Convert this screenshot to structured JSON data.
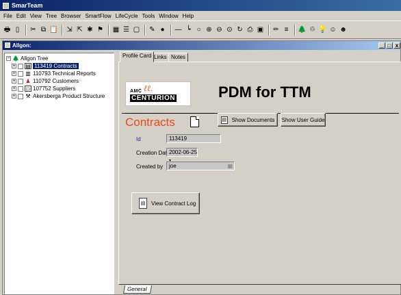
{
  "app": {
    "title": "SmarTeam"
  },
  "menu": [
    "File",
    "Edit",
    "View",
    "Tree",
    "Browser",
    "SmartFlow",
    "LifeCycle",
    "Tools",
    "Window",
    "Help"
  ],
  "child_window": {
    "title": "Allgon:",
    "controls": [
      "_",
      "□",
      "x"
    ]
  },
  "tree": {
    "root": "Allgon Tree",
    "items": [
      {
        "label": "113419 Contracts",
        "selected": true
      },
      {
        "label": "110793 Technical Reports",
        "selected": false
      },
      {
        "label": "110792 Customers",
        "selected": false
      },
      {
        "label": "107752 Suppliers",
        "selected": false
      },
      {
        "label": "Akersberga Product Structure",
        "selected": false
      }
    ]
  },
  "tabs": [
    "Profile Card",
    "Links",
    "Notes"
  ],
  "profile": {
    "logo_text_top": "AMC",
    "logo_text_main": "CENTURION",
    "heading": "PDM for TTM",
    "section_title": "Contracts",
    "show_documents_label": "Show Documents",
    "show_user_guide_label": "Show User Guide",
    "fields": {
      "id_label": "Id",
      "id_value": "113419",
      "creation_date_label": "Creation Date",
      "creation_date_value": "2002-06-25",
      "created_by_label": "Created by",
      "created_by_value": "joe"
    },
    "view_contract_log_label": "View Contract Log"
  },
  "bottom_tab": "General",
  "colors": {
    "title_bar": "#0a246a",
    "section_title": "#e84a1b",
    "logo_accent": "#e05a2b"
  }
}
